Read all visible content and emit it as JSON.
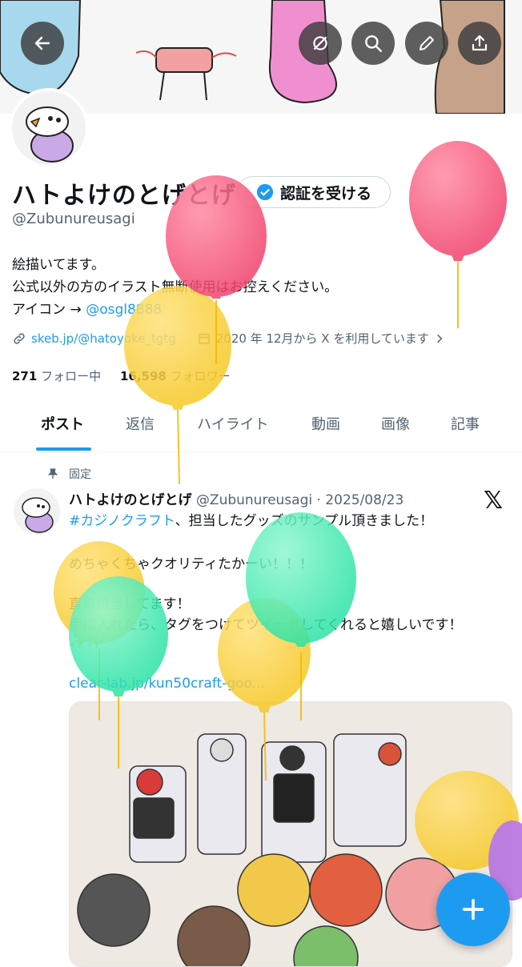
{
  "profile": {
    "name": "ハトよけのとげとげ",
    "verify_label": "認証を受ける",
    "handle": "@Zubunureusagi",
    "bio_line1": "絵描いてます。",
    "bio_line2": "公式以外の方のイラスト無断使用はお控えください。",
    "bio_line3_prefix": "アイコン → ",
    "bio_line3_link": "@osgl8888",
    "website": "skeb.jp/@hatoyoke_tgtg",
    "joined": "2020 年 12月から X を利用しています",
    "following_count": "271",
    "following_label": "フォロー中",
    "followers_count": "16,598",
    "followers_label": "フォロワー"
  },
  "tabs": [
    "ポスト",
    "返信",
    "ハイライト",
    "動画",
    "画像",
    "記事"
  ],
  "post": {
    "pinned_label": "固定",
    "author": "ハトよけのとげとげ",
    "handle_date": "@Zubunureusagi · 2025/08/23",
    "hashtag": "#カジノクラフト",
    "line1_rest": "、担当したグッズのサンプル頂きました！",
    "line2": "めちゃくちゃクオリティたかーい！！！",
    "line3": "直筆担当してます！",
    "line4": "手に入れたら、タグをつけてツイートしてくれると嬉しいです！",
    "line5": "✨✨",
    "link": "clear-lab.jp/kun50craft-goo..."
  },
  "icons": [
    "back-arrow-icon",
    "mute-icon",
    "search-icon",
    "edit-icon",
    "share-icon",
    "verified-badge-icon",
    "link-icon",
    "calendar-icon",
    "chevron-right-icon",
    "pin-icon",
    "x-logo-icon",
    "plus-icon"
  ],
  "colors": {
    "accent": "#1d9bf0",
    "text": "#0f1419",
    "muted": "#536471",
    "balloon_red": "#f2456e",
    "balloon_yellow": "#f7c928",
    "balloon_green": "#2fe3a7"
  }
}
